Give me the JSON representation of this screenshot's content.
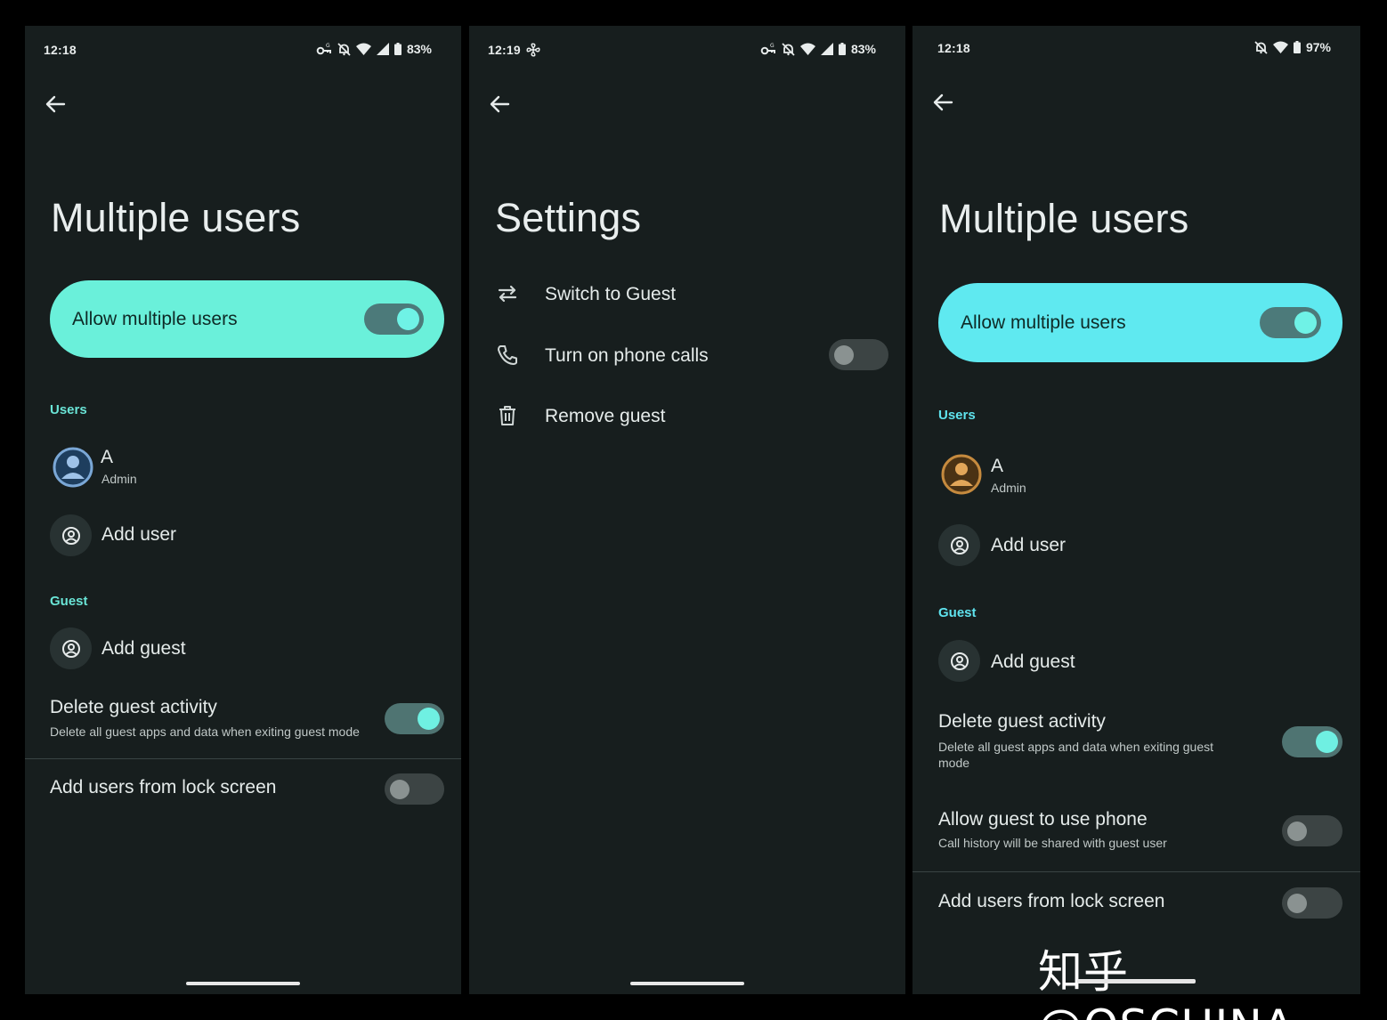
{
  "screens": {
    "left": {
      "status": {
        "time": "12:18",
        "battery": "83%"
      },
      "title": "Multiple users",
      "master_toggle": {
        "label": "Allow multiple users",
        "on": true
      },
      "users_header": "Users",
      "user_a": {
        "name": "A",
        "role": "Admin"
      },
      "add_user": "Add user",
      "guest_header": "Guest",
      "add_guest": "Add guest",
      "delete_guest": {
        "title": "Delete guest activity",
        "subtitle": "Delete all guest apps and data when exiting guest mode",
        "on": true
      },
      "lock_screen": {
        "title": "Add users from lock screen",
        "on": false
      }
    },
    "middle": {
      "status": {
        "time": "12:19",
        "battery": "83%"
      },
      "title": "Settings",
      "items": [
        {
          "label": "Switch to Guest",
          "icon": "swap-icon"
        },
        {
          "label": "Turn on phone calls",
          "icon": "phone-icon",
          "toggle": false
        },
        {
          "label": "Remove guest",
          "icon": "trash-icon"
        }
      ]
    },
    "right": {
      "status": {
        "time": "12:18",
        "battery": "97%"
      },
      "title": "Multiple users",
      "master_toggle": {
        "label": "Allow multiple users",
        "on": true
      },
      "users_header": "Users",
      "user_a": {
        "name": "A",
        "role": "Admin"
      },
      "add_user": "Add user",
      "guest_header": "Guest",
      "add_guest": "Add guest",
      "delete_guest": {
        "title": "Delete guest activity",
        "subtitle": "Delete all guest apps and data when exiting guest mode",
        "on": true
      },
      "guest_phone": {
        "title": "Allow guest to use phone",
        "subtitle": "Call history will be shared with guest user",
        "on": false
      },
      "lock_screen": {
        "title": "Add users from lock screen",
        "on": false
      }
    }
  },
  "watermark": "知乎 @OSCHINA",
  "colors": {
    "background": "#171e1e",
    "accent_left": "#6af0da",
    "accent_right": "#5fe9f0",
    "section_header": "#6ae4d6"
  }
}
